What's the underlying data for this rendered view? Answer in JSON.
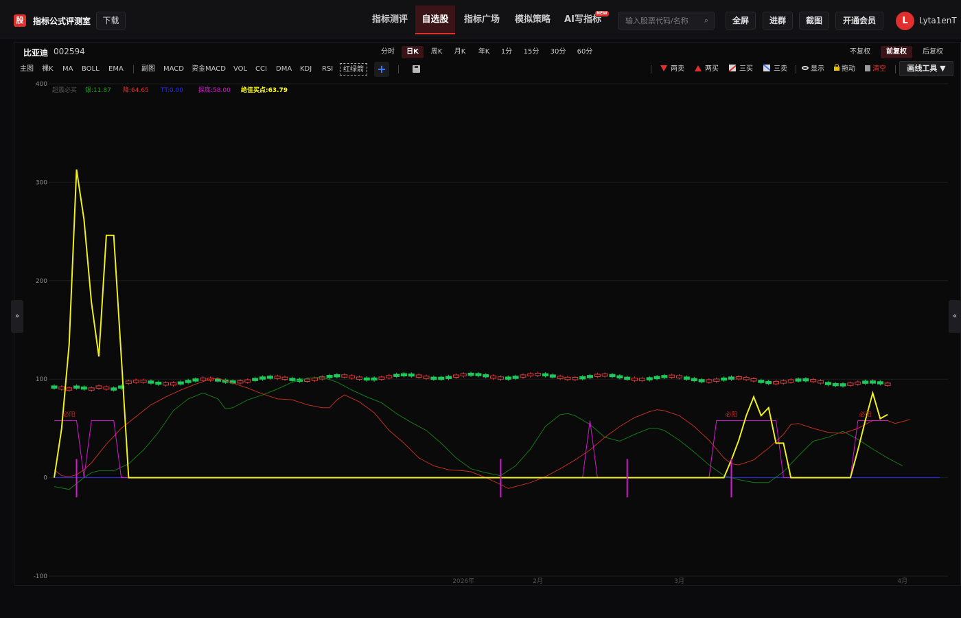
{
  "header": {
    "logo_char": "股",
    "app_name": "指标公式评测室",
    "download": "下载",
    "nav": [
      {
        "label": "指标测评",
        "active": false
      },
      {
        "label": "自选股",
        "active": true
      },
      {
        "label": "指标广场",
        "active": false
      },
      {
        "label": "模拟策略",
        "active": false
      },
      {
        "label": "AI写指标",
        "active": false
      }
    ],
    "new_badge": "NEW",
    "search_placeholder": "输入股票代码/名称",
    "buttons": {
      "fullscreen": "全屏",
      "group": "进群",
      "screenshot": "截图",
      "vip": "开通会员"
    },
    "avatar_initial": "L",
    "username": "Lyta1enT"
  },
  "stock": {
    "name": "比亚迪",
    "code": "002594"
  },
  "periods": [
    {
      "label": "分时",
      "active": false
    },
    {
      "label": "日K",
      "active": true
    },
    {
      "label": "周K",
      "active": false
    },
    {
      "label": "月K",
      "active": false
    },
    {
      "label": "年K",
      "active": false
    },
    {
      "label": "1分",
      "active": false
    },
    {
      "label": "15分",
      "active": false
    },
    {
      "label": "30分",
      "active": false
    },
    {
      "label": "60分",
      "active": false
    }
  ],
  "adjust": [
    {
      "label": "不复权",
      "active": false
    },
    {
      "label": "前复权",
      "active": true
    },
    {
      "label": "后复权",
      "active": false
    }
  ],
  "toolbar": {
    "main": "主图",
    "naked_k": "裸K",
    "ma": "MA",
    "boll": "BOLL",
    "ema": "EMA",
    "sub": "副图",
    "macd": "MACD",
    "fund_macd": "资金MACD",
    "vol": "VOL",
    "cci": "CCI",
    "dma": "DMA",
    "kdj": "KDJ",
    "rsi": "RSI",
    "hlj": "红绿箭",
    "add": "+"
  },
  "right_tools": {
    "two_sell": "两卖",
    "two_buy": "两买",
    "three_buy": "三买",
    "three_sell": "三卖",
    "show": "显示",
    "drag": "拖动",
    "clear": "清空",
    "draw_tools": "画线工具 ▼"
  },
  "indicator_legend": {
    "name": "超震必买",
    "items": [
      {
        "label": "银:11.87",
        "color": "#1f9a1f"
      },
      {
        "label": "降:64.65",
        "color": "#e0302d"
      },
      {
        "label": "TT:0.00",
        "color": "#2b2bff"
      },
      {
        "label": "探底:58.00",
        "color": "#d816d8"
      },
      {
        "label": "绝佳买点:63.79",
        "color": "#ffff00"
      }
    ]
  },
  "colors": {
    "up": "#e03c3c",
    "down": "#1fc85a",
    "yellow": "#f0f020",
    "red_line": "#c03020",
    "green_line": "#157a15",
    "magenta": "#d816d8",
    "blue": "#2b2bff"
  },
  "chart_data": {
    "type": "line",
    "y_ticks": [
      "400",
      "300",
      "200",
      "100",
      "0",
      "-100"
    ],
    "ylim": [
      -100,
      400
    ],
    "x_axis_labels": [
      {
        "label": "2026年",
        "index": 55
      },
      {
        "label": "2月",
        "index": 65
      },
      {
        "label": "3月",
        "index": 84
      },
      {
        "label": "4月",
        "index": 114
      }
    ],
    "n": 120,
    "signal_label": "必阳",
    "series": [
      {
        "name": "绝佳买点",
        "role": "yellow",
        "points": [
          [
            0,
            0
          ],
          [
            1,
            50
          ],
          [
            2,
            135
          ],
          [
            3,
            313
          ],
          [
            4,
            262
          ],
          [
            5,
            178
          ],
          [
            6,
            123
          ],
          [
            7,
            246
          ],
          [
            8,
            246
          ],
          [
            9,
            124
          ],
          [
            10,
            0
          ],
          [
            90,
            0
          ],
          [
            91,
            18
          ],
          [
            92,
            38
          ],
          [
            93,
            63
          ],
          [
            94,
            82
          ],
          [
            95,
            63
          ],
          [
            96,
            71
          ],
          [
            97,
            35
          ],
          [
            98,
            35
          ],
          [
            99,
            0
          ],
          [
            107,
            0
          ],
          [
            108,
            28
          ],
          [
            109,
            58
          ],
          [
            110,
            86
          ],
          [
            111,
            60
          ],
          [
            112,
            64
          ]
        ]
      },
      {
        "name": "降",
        "role": "red",
        "points": [
          [
            0,
            8
          ],
          [
            1,
            2
          ],
          [
            2,
            1
          ],
          [
            3,
            3
          ],
          [
            4,
            8
          ],
          [
            5,
            15
          ],
          [
            7,
            34
          ],
          [
            9,
            50
          ],
          [
            11,
            62
          ],
          [
            13,
            74
          ],
          [
            15,
            82
          ],
          [
            17,
            89
          ],
          [
            19,
            95
          ],
          [
            21,
            100
          ],
          [
            22,
            101
          ],
          [
            24,
            96
          ],
          [
            26,
            91
          ],
          [
            28,
            85
          ],
          [
            30,
            80
          ],
          [
            32,
            79
          ],
          [
            34,
            74
          ],
          [
            36,
            71
          ],
          [
            37,
            71
          ],
          [
            38,
            79
          ],
          [
            39,
            84
          ],
          [
            41,
            77
          ],
          [
            43,
            66
          ],
          [
            45,
            48
          ],
          [
            47,
            35
          ],
          [
            49,
            20
          ],
          [
            51,
            12
          ],
          [
            53,
            8
          ],
          [
            55,
            7
          ],
          [
            56,
            6
          ],
          [
            58,
            0
          ],
          [
            60,
            -7
          ],
          [
            61,
            -11
          ],
          [
            62,
            -9
          ],
          [
            64,
            -5
          ],
          [
            66,
            1
          ],
          [
            68,
            9
          ],
          [
            70,
            18
          ],
          [
            72,
            28
          ],
          [
            74,
            41
          ],
          [
            76,
            52
          ],
          [
            78,
            61
          ],
          [
            80,
            67
          ],
          [
            81,
            69
          ],
          [
            82,
            68
          ],
          [
            84,
            63
          ],
          [
            86,
            52
          ],
          [
            88,
            38
          ],
          [
            90,
            20
          ],
          [
            91,
            14
          ],
          [
            92,
            13
          ],
          [
            94,
            18
          ],
          [
            96,
            30
          ],
          [
            98,
            44
          ],
          [
            99,
            54
          ],
          [
            100,
            55
          ],
          [
            102,
            50
          ],
          [
            104,
            46
          ],
          [
            106,
            45
          ],
          [
            108,
            50
          ],
          [
            110,
            58
          ],
          [
            112,
            58
          ],
          [
            113,
            55
          ],
          [
            115,
            59
          ]
        ]
      },
      {
        "name": "银",
        "role": "green",
        "points": [
          [
            0,
            -9
          ],
          [
            2,
            -12
          ],
          [
            3,
            -6
          ],
          [
            4,
            0
          ],
          [
            5,
            5
          ],
          [
            6,
            7
          ],
          [
            8,
            7
          ],
          [
            10,
            14
          ],
          [
            12,
            28
          ],
          [
            14,
            46
          ],
          [
            16,
            68
          ],
          [
            18,
            80
          ],
          [
            20,
            86
          ],
          [
            22,
            80
          ],
          [
            23,
            70
          ],
          [
            24,
            71
          ],
          [
            26,
            79
          ],
          [
            28,
            84
          ],
          [
            30,
            90
          ],
          [
            32,
            97
          ],
          [
            34,
            101
          ],
          [
            36,
            102
          ],
          [
            38,
            97
          ],
          [
            40,
            89
          ],
          [
            42,
            82
          ],
          [
            44,
            76
          ],
          [
            46,
            65
          ],
          [
            48,
            56
          ],
          [
            50,
            48
          ],
          [
            52,
            35
          ],
          [
            54,
            20
          ],
          [
            56,
            9
          ],
          [
            58,
            5
          ],
          [
            60,
            2
          ],
          [
            62,
            12
          ],
          [
            64,
            29
          ],
          [
            66,
            52
          ],
          [
            68,
            64
          ],
          [
            69,
            65
          ],
          [
            70,
            63
          ],
          [
            72,
            54
          ],
          [
            74,
            41
          ],
          [
            76,
            37
          ],
          [
            78,
            44
          ],
          [
            80,
            50
          ],
          [
            81,
            50
          ],
          [
            82,
            48
          ],
          [
            84,
            38
          ],
          [
            86,
            26
          ],
          [
            88,
            13
          ],
          [
            90,
            2
          ],
          [
            92,
            -2
          ],
          [
            94,
            -5
          ],
          [
            96,
            -5
          ],
          [
            98,
            6
          ],
          [
            100,
            22
          ],
          [
            102,
            37
          ],
          [
            104,
            41
          ],
          [
            106,
            47
          ],
          [
            108,
            39
          ],
          [
            110,
            29
          ],
          [
            112,
            20
          ],
          [
            114,
            12
          ]
        ]
      },
      {
        "name": "探底",
        "role": "magenta",
        "points": [
          [
            0,
            58
          ],
          [
            3,
            58
          ],
          [
            4,
            0
          ],
          [
            5,
            58
          ],
          [
            8,
            58
          ],
          [
            9,
            0
          ],
          [
            60,
            0
          ],
          [
            71,
            0
          ],
          [
            72,
            58
          ],
          [
            73,
            0
          ],
          [
            88,
            0
          ],
          [
            89,
            58
          ],
          [
            97,
            58
          ],
          [
            98,
            0
          ],
          [
            107,
            0
          ],
          [
            108,
            58
          ],
          [
            112,
            58
          ]
        ]
      },
      {
        "name": "TT",
        "role": "blue",
        "points": [
          [
            0,
            0
          ],
          [
            119,
            0
          ]
        ]
      }
    ],
    "spikes": [
      3,
      60,
      77,
      91
    ],
    "signal_markers": [
      2,
      91,
      109
    ],
    "candles": {
      "start_index": 0,
      "end_index": 112,
      "ohlc_summary": "daily candles along ~90-110 band"
    }
  }
}
